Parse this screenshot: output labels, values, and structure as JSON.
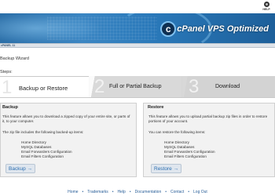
{
  "header": {
    "help_label": "HELP",
    "brand_mark": "c",
    "brand_text": "cPanel VPS Optimized",
    "accent_color": "#2a79ba"
  },
  "breadcrumb": {
    "text": "cPANEL 11"
  },
  "page": {
    "title": "Backup Wizard",
    "steps_label": "Steps:"
  },
  "tabs": [
    {
      "number": "1",
      "label": "Backup or Restore",
      "active": true
    },
    {
      "number": "2",
      "label": "Full or Partial Backup",
      "active": false
    },
    {
      "number": "3",
      "label": "Download",
      "active": false
    }
  ],
  "backup_panel": {
    "title": "Backup",
    "description": "This feature allows you to download a zipped copy of your entire site, or parts of it, to your computer.",
    "intro": "The zip file includes the following backed-up items:",
    "items": [
      "Home Directory",
      "MySQL Databases",
      "Email Forwarders Configuration",
      "Email Filters Configuration"
    ],
    "button_label": "Backup →"
  },
  "restore_panel": {
    "title": "Restore",
    "description": "This feature allows you to upload partial backup zip files in order to restore portions of your account.",
    "intro": "You can restore the following items:",
    "items": [
      "Home Directory",
      "MySQL Databases",
      "Email Forwarders Configuration",
      "Email Filters Configuration"
    ],
    "button_label": "Restore →"
  },
  "footer": {
    "links": [
      "Home",
      "Trademarks",
      "Help",
      "Documentation",
      "Contact",
      "Log Out"
    ]
  }
}
